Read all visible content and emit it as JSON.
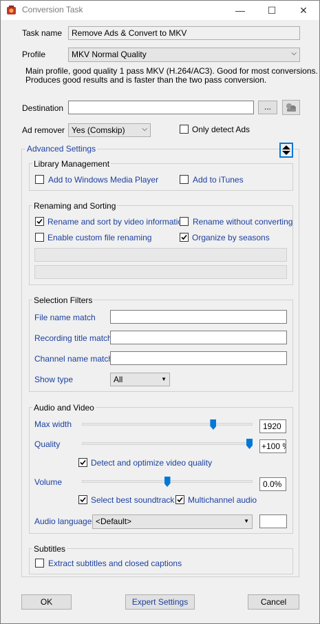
{
  "window": {
    "title": "Conversion Task",
    "minimize_glyph": "—",
    "maximize_glyph": "☐",
    "close_glyph": "✕",
    "app_icon": "app-icon"
  },
  "task": {
    "task_name_label": "Task name",
    "task_name_value": "Remove Ads & Convert to MKV",
    "profile_label": "Profile",
    "profile_value": "MKV Normal Quality",
    "profile_description_line1": "Main profile, good quality 1 pass MKV (H.264/AC3). Good for most conversions.",
    "profile_description_line2": "Produces good results and is faster than the two pass conversion.",
    "destination_label": "Destination",
    "destination_value": "",
    "browse_label": "...",
    "ad_remover_label": "Ad remover",
    "ad_remover_value": "Yes (Comskip)",
    "only_detect_ads_label": "Only detect Ads",
    "only_detect_ads_checked": false
  },
  "advanced": {
    "title": "Advanced Settings"
  },
  "library": {
    "title": "Library Management",
    "add_wmp_label": "Add to Windows Media Player",
    "add_wmp_checked": false,
    "add_itunes_label": "Add to iTunes",
    "add_itunes_checked": false
  },
  "renaming": {
    "title": "Renaming and Sorting",
    "rename_sort_label": "Rename and sort by video information",
    "rename_sort_checked": true,
    "rename_without_label": "Rename without converting",
    "rename_without_checked": false,
    "custom_rename_label": "Enable custom file renaming",
    "custom_rename_checked": false,
    "organize_label": "Organize by seasons",
    "organize_checked": true
  },
  "filters": {
    "title": "Selection Filters",
    "file_name_label": "File name match",
    "recording_title_label": "Recording title match",
    "channel_name_label": "Channel name match",
    "show_type_label": "Show type",
    "show_type_value": "All"
  },
  "av": {
    "title": "Audio and Video",
    "max_width_label": "Max width",
    "max_width_value": "1920",
    "max_width_level": 0.78,
    "quality_label": "Quality",
    "quality_value": "+100 %",
    "quality_level": 1.0,
    "detect_optimize_label": "Detect and optimize video quality",
    "detect_optimize_checked": true,
    "volume_label": "Volume",
    "volume_value": "0.0%",
    "volume_level": 0.5,
    "best_soundtrack_label": "Select best soundtrack",
    "best_soundtrack_checked": true,
    "multichannel_label": "Multichannel audio",
    "multichannel_checked": true,
    "audio_language_label": "Audio language",
    "audio_language_value": "<Default>"
  },
  "subtitles": {
    "title": "Subtitles",
    "extract_label": "Extract subtitles and closed captions",
    "extract_checked": false
  },
  "footer": {
    "ok_label": "OK",
    "expert_label": "Expert Settings",
    "cancel_label": "Cancel"
  },
  "colors": {
    "accent": "#0078d7",
    "link_blue": "#1a3fa0"
  }
}
